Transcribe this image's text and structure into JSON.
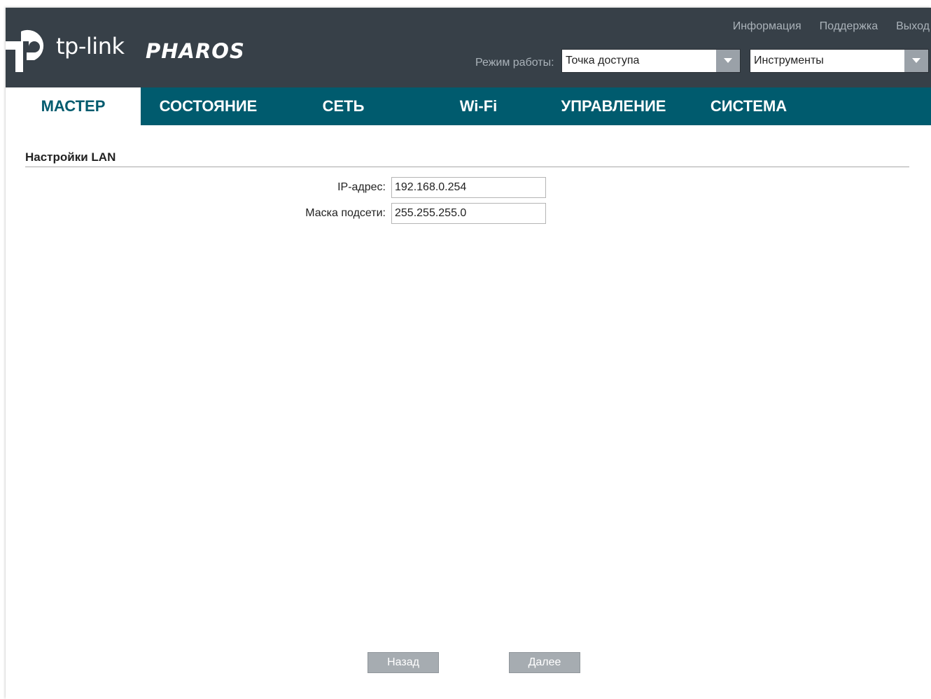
{
  "header": {
    "logo_wordmark": "tp-link",
    "logo_product": "PHAROS",
    "links": {
      "info": "Информация",
      "support": "Поддержка",
      "logout": "Выход"
    },
    "mode_label": "Режим работы:",
    "mode_value": "Точка доступа",
    "tools_value": "Инструменты"
  },
  "nav": {
    "tabs": [
      {
        "label": "МАСТЕР",
        "active": true
      },
      {
        "label": "СОСТОЯНИЕ",
        "active": false
      },
      {
        "label": "СЕТЬ",
        "active": false
      },
      {
        "label": "Wi-Fi",
        "active": false
      },
      {
        "label": "УПРАВЛЕНИЕ",
        "active": false
      },
      {
        "label": "СИСТЕМА",
        "active": false
      }
    ]
  },
  "main": {
    "section_title": "Настройки LAN",
    "ip_label": "IP-адрес:",
    "ip_value": "192.168.0.254",
    "mask_label": "Маска подсети:",
    "mask_value": "255.255.255.0"
  },
  "buttons": {
    "back": "Назад",
    "next": "Далее"
  },
  "colors": {
    "header_bg": "#374048",
    "nav_bg": "#005b6e",
    "button_bg": "#a6acb1"
  }
}
